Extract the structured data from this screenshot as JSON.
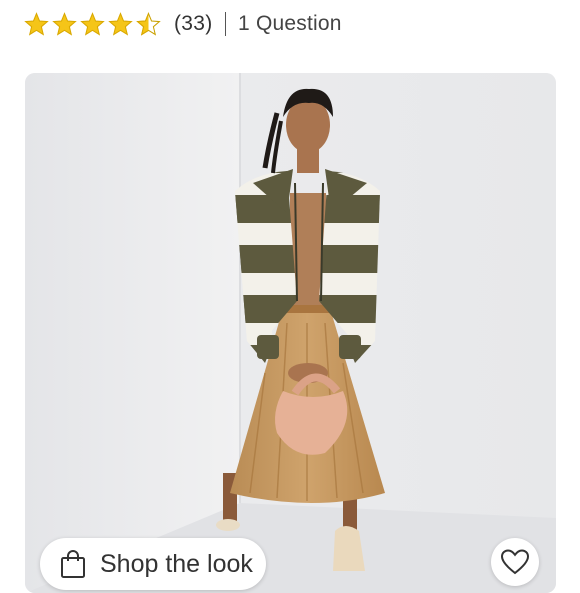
{
  "rating": {
    "value": 4.5,
    "max": 5,
    "review_count": "(33)",
    "question_link": "1 Question"
  },
  "icons": {
    "star": "star-icon",
    "bag": "shopping-bag-icon",
    "heart": "heart-icon"
  },
  "colors": {
    "star_fill": "#F5C518",
    "star_stroke": "#D9A800",
    "text": "#333333",
    "photo_background": "#EEEEEF"
  },
  "shop_the_look": {
    "label": "Shop the look"
  }
}
